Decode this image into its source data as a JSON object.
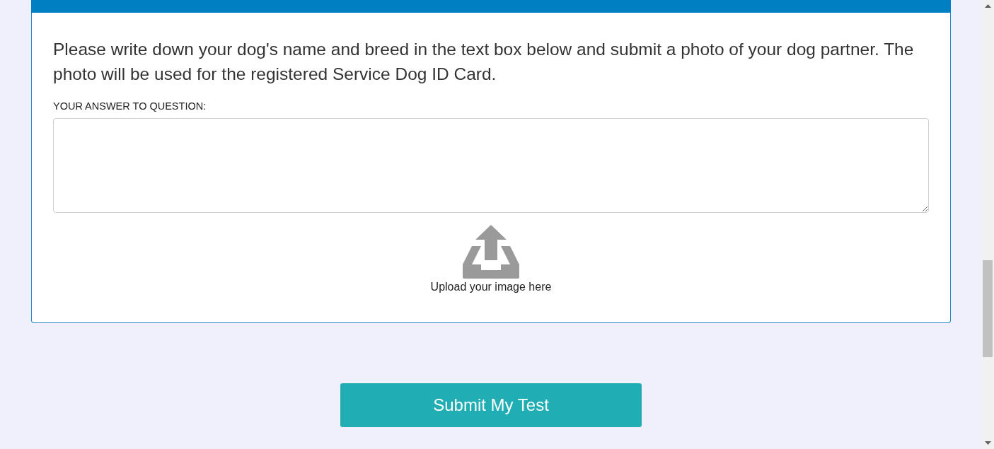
{
  "card": {
    "question": "Please write down your dog's name and breed in the text box below and submit a photo of your dog partner. The photo will be used for the registered Service Dog ID Card.",
    "answer_label": "YOUR ANSWER TO QUESTION:",
    "upload": {
      "label": "Upload your image here"
    }
  },
  "submit_button": {
    "label": "Submit My Test"
  }
}
